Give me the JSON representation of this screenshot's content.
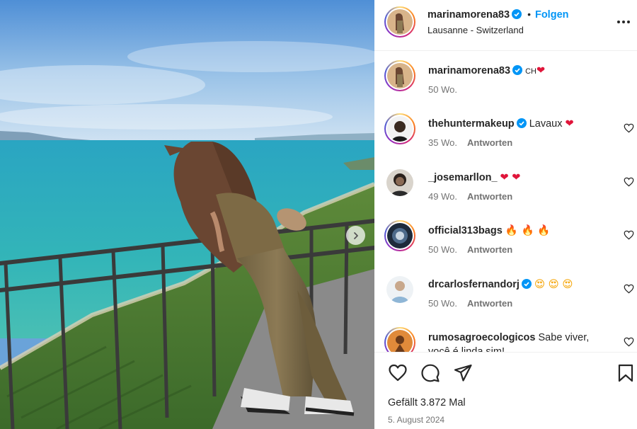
{
  "post": {
    "author": "marinamorena83",
    "verified": true,
    "follow_label": "Folgen",
    "separator": "•",
    "location": "Lausanne - Switzerland",
    "more_icon": "more-horizontal-icon",
    "photo_alt": "",
    "next_icon": "chevron-right-icon"
  },
  "comments": [
    {
      "user": "marinamorena83",
      "verified": true,
      "text": "",
      "tag": "CH",
      "emoji": "❤",
      "time": "50 Wo.",
      "reply": ""
    },
    {
      "user": "thehuntermakeup",
      "verified": true,
      "text": "Lavaux ",
      "emoji": "❤",
      "time": "35 Wo.",
      "reply": "Antworten"
    },
    {
      "user": "_josemarllon_",
      "verified": false,
      "text": "",
      "emoji": "❤ ❤",
      "time": "49 Wo.",
      "reply": "Antworten"
    },
    {
      "user": "official313bags",
      "verified": false,
      "text": "",
      "emoji": "🔥 🔥 🔥",
      "time": "50 Wo.",
      "reply": "Antworten"
    },
    {
      "user": "drcarlosfernandorj",
      "verified": true,
      "text": "",
      "emoji": "😍 😍 😍",
      "time": "50 Wo.",
      "reply": "Antworten"
    },
    {
      "user": "rumosagroecologicos",
      "verified": false,
      "text": "Sabe viver, você é linda sim!",
      "emoji": "",
      "time": "",
      "reply": ""
    }
  ],
  "actions": {
    "like_icon": "heart-icon",
    "comment_icon": "comment-icon",
    "share_icon": "send-icon",
    "save_icon": "bookmark-icon"
  },
  "likes_text": "Gefällt 3.872 Mal",
  "date_text": "5. August 2024",
  "colors": {
    "follow_blue": "#0095f6",
    "verified_blue": "#0095f6",
    "text": "#262626",
    "muted": "#737373",
    "heart_red": "#e0153a"
  }
}
